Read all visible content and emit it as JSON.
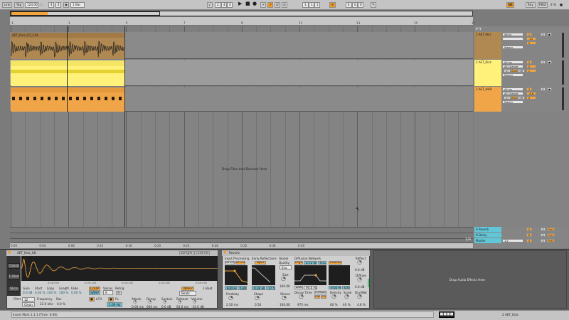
{
  "transport": {
    "link": "Link",
    "tap": "Tap",
    "tempo": "124.00",
    "sig_num": "4",
    "sig_den": "4",
    "quant": "1 Bar",
    "position": [
      "2.",
      "4.",
      "4"
    ],
    "loop_start": [
      "1.",
      "1.",
      "1"
    ],
    "loop_len": [
      "4.",
      "0.",
      "0"
    ]
  },
  "topright": {
    "key": "Key",
    "midi": "MIDI",
    "cpu": "2 %"
  },
  "ruler": {
    "beat_marks": [
      "-1",
      "3",
      "5",
      "7",
      "9",
      "11",
      "13",
      "15",
      "17"
    ],
    "time_marks": [
      "0:00",
      "0:04",
      "0:08",
      "0:12",
      "0:16",
      "0:20",
      "0:24",
      "0:28",
      "0:32",
      "0:36",
      "0:40"
    ],
    "clip_marks": [
      "-1",
      "-2",
      "-3"
    ]
  },
  "tracks": [
    {
      "name": "1 AET_Perc",
      "clip": "AET_Perc_01_124",
      "input": "Set In",
      "route": "",
      "out": "Master",
      "vol": "-14",
      "pan": "0",
      "num": "1",
      "color": "#b08851"
    },
    {
      "name": "2 AET_Kick",
      "clip": "",
      "input": "All Ins",
      "channel": "All Channe",
      "monitor": [
        "In",
        "Auto",
        "Off"
      ],
      "out": "Master",
      "vol": "0",
      "pan": "C",
      "num": "2",
      "color": "#fff17a"
    },
    {
      "name": "3 AET_HHD",
      "clip": "",
      "input": "All Ins",
      "channel": "All Channe",
      "monitor": [
        "In",
        "Auto",
        "Off"
      ],
      "out": "Master",
      "vol": "-4.8",
      "pan": "0",
      "num": "3",
      "color": "#f0a648"
    }
  ],
  "returns": [
    {
      "name": "A Reverb",
      "letter": "A",
      "color": "#61c7d8"
    },
    {
      "name": "B Delay",
      "letter": "B",
      "color": "#61c7d8"
    },
    {
      "name": "Master",
      "letter": "0",
      "out": "1/2",
      "color": "#61c7d8"
    }
  ],
  "drop_hint": "Drop Files and Devices Here",
  "drop_hint_fx": "Drop Audio Effects Here",
  "zoom": "1/4",
  "sampler": {
    "title": "AET_Kick_08",
    "tab_sample": "Sample",
    "tab_controls": "Controls",
    "left_btns": [
      "Classic",
      "1-Shot",
      "Slice"
    ],
    "params": [
      {
        "l": "Gain",
        "v": "0.0 dB"
      },
      {
        "l": "Start",
        "v": "0.00 %"
      },
      {
        "l": "Loop",
        "v": "100 %"
      },
      {
        "l": "Length",
        "v": "100 %"
      },
      {
        "l": "Fade",
        "v": "0.00 %"
      }
    ],
    "loop": "LOOP",
    "snap": "SNAP",
    "voices_l": "Voices",
    "voices": "6",
    "retrig": "Retrig",
    "warp": "WARP",
    "beats": "Beats",
    "beat": "1 Beat",
    "filter": "Filter",
    "freq_l": "Frequency",
    "res_l": "Res",
    "freq": "22.0 kHz",
    "res": "0.0 %",
    "lfo": "LFO",
    "fe": "Fe",
    "env": [
      {
        "l": "Attack",
        "v": "0.00 ms"
      },
      {
        "l": "Decay",
        "v": "600 ms"
      },
      {
        "l": "Sustain",
        "v": "0.0 dB"
      },
      {
        "l": "Release",
        "v": "50.0 ms"
      },
      {
        "l": "Volume",
        "v": "-12.0 dB"
      }
    ],
    "time_labels": [
      "0:00:000",
      "0:00:100",
      "0:00:200",
      "0:00:300",
      "0:00:400"
    ],
    "hz": "1.00 Hz"
  },
  "reverb": {
    "title": "Reverb",
    "input": "Input Processing",
    "lo": "Lo Cut",
    "hi": "Hi Cut",
    "freq1": "830 Hz",
    "w1": "5.85",
    "predelay_l": "Predelay",
    "predelay": "2.50 ms",
    "early": "Early Reflections",
    "spin": "Spin",
    "f2": "0.30 Hz",
    "amt": "17.5",
    "shape_l": "Shape",
    "shape": "0.50",
    "global": "Global",
    "quality": "Quality",
    "eco": "Eco",
    "size_l": "Size",
    "size": "100.00",
    "stereo_l": "Stereo",
    "stereo": "100.00",
    "diffusion": "Diffusion Network",
    "high": "High",
    "hf": "2.72 kHz",
    "hv": "0.53",
    "low": "Low",
    "lf": "90.0 Hz",
    "chorus": "Chorus",
    "cf": "0.02 Hz",
    "cv": "0.02",
    "decay_l": "Decay Time",
    "decay": "975 ms",
    "freeze": "Freeze",
    "flat": "Flat",
    "cut": "Cut",
    "density_l": "Density",
    "density": "60 %",
    "scale_l": "Scale",
    "scale": "40 %",
    "reflect_l": "Reflect",
    "reflect": "0.0 dB",
    "diffuse_l": "Diffuse",
    "diffuse": "0.0 dB",
    "drywet_l": "Dry/Wet",
    "drywet": "4.8 %"
  },
  "status": {
    "text": "Insert Mark 1.1.1 (Time: 0:00)",
    "right": "2 AET_Kick"
  }
}
